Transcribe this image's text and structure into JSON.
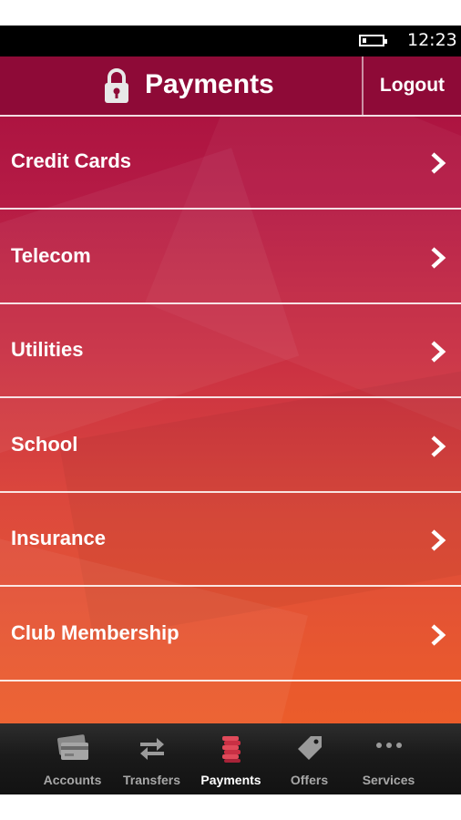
{
  "status_bar": {
    "time": "12:23",
    "battery_level": 0.15
  },
  "header": {
    "title": "Payments",
    "logout_label": "Logout",
    "icon": "lock-icon"
  },
  "menu": {
    "items": [
      {
        "label": "Credit Cards",
        "icon": "chevron-right-icon"
      },
      {
        "label": "Telecom",
        "icon": "chevron-right-icon"
      },
      {
        "label": "Utilities",
        "icon": "chevron-right-icon"
      },
      {
        "label": "School",
        "icon": "chevron-right-icon"
      },
      {
        "label": "Insurance",
        "icon": "chevron-right-icon"
      },
      {
        "label": "Club Membership",
        "icon": "chevron-right-icon"
      }
    ]
  },
  "bottom_nav": {
    "items": [
      {
        "label": "Accounts",
        "icon": "cards-icon"
      },
      {
        "label": "Transfers",
        "icon": "swap-arrows-icon"
      },
      {
        "label": "Payments",
        "icon": "coin-stack-icon",
        "active": true
      },
      {
        "label": "Offers",
        "icon": "tag-icon"
      },
      {
        "label": "Services",
        "icon": "more-dots-icon"
      }
    ]
  },
  "colors": {
    "header": "#8e0a37",
    "gradient_top": "#a70f3d",
    "gradient_bottom": "#ef6125",
    "nav_background": "#1a1a1a",
    "nav_active_icon": "#d4344a"
  }
}
